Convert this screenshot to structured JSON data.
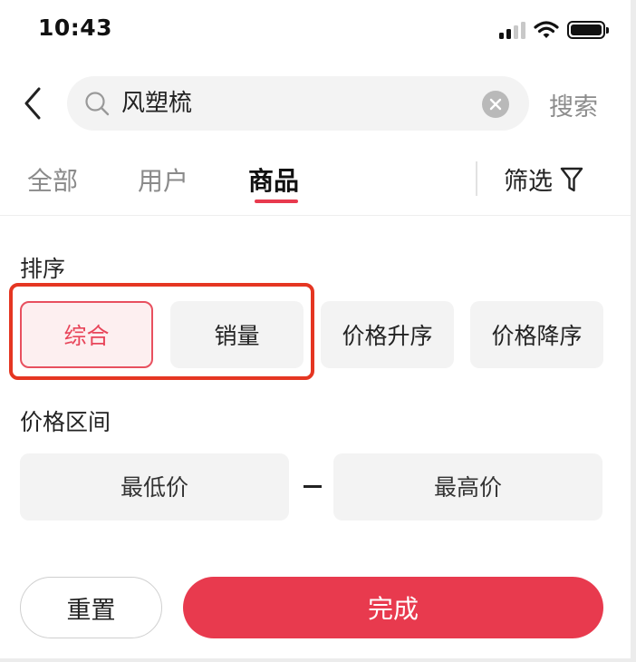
{
  "status_bar": {
    "time": "10:43",
    "icons": [
      "cellular-signal-icon",
      "wifi-icon",
      "battery-icon"
    ]
  },
  "search": {
    "query": "风塑梳",
    "search_button": "搜索",
    "icons": [
      "back-chevron-icon",
      "search-icon",
      "clear-icon"
    ]
  },
  "tabs": [
    {
      "label": "全部",
      "active": false
    },
    {
      "label": "用户",
      "active": false
    },
    {
      "label": "商品",
      "active": true
    }
  ],
  "filter": {
    "label": "筛选",
    "icon": "funnel-icon"
  },
  "sort": {
    "label": "排序",
    "options": [
      {
        "label": "综合",
        "selected": true
      },
      {
        "label": "销量",
        "selected": false
      },
      {
        "label": "价格升序",
        "selected": false
      },
      {
        "label": "价格降序",
        "selected": false
      }
    ]
  },
  "price_range": {
    "label": "价格区间",
    "min_placeholder": "最低价",
    "max_placeholder": "最高价"
  },
  "footer": {
    "reset_label": "重置",
    "done_label": "完成"
  },
  "colors": {
    "accent": "#e83a4e",
    "selected_chip_bg": "#fdeff0",
    "annotation_outline": "#e53622",
    "chip_bg": "#f3f3f3"
  }
}
